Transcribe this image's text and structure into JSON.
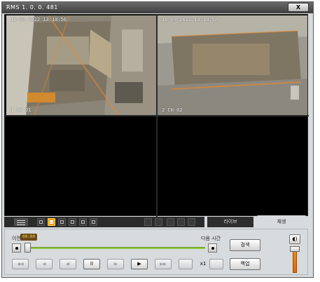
{
  "window": {
    "title": "RMS 1. 0. 0. 481",
    "close_label": "X"
  },
  "cameras": [
    {
      "timestamp": "16-09-2022 13:10:56",
      "label": "1 CH 01"
    },
    {
      "timestamp": "16-09-2022 13:10:58",
      "label": "2 CH 02"
    }
  ],
  "toolbar": {
    "icons": [
      "list-icon",
      "layout-1-icon",
      "layout-4-icon",
      "layout-9-icon",
      "layout-16-icon",
      "layout-25-icon",
      "layout-36-icon",
      "undo-icon",
      "redo-icon",
      "snapshot-icon",
      "fullscreen-icon",
      "eraser-icon"
    ]
  },
  "tabs": {
    "live": "라이브",
    "playback": "재생"
  },
  "timeline": {
    "prev_label": "이전",
    "next_label": "다음 시간",
    "current_time": "00:00",
    "position": 0.0
  },
  "playback": {
    "speed": "x1",
    "play_icon": "▶",
    "pause_icon": "II"
  },
  "buttons": {
    "search": "검색",
    "backup": "백업"
  },
  "volume": {
    "icon": "speaker-icon",
    "level": 1.0,
    "accent": "#f08a12"
  },
  "colors": {
    "timeline": "#8dc63f",
    "selected_layout": "#e8a21a"
  }
}
